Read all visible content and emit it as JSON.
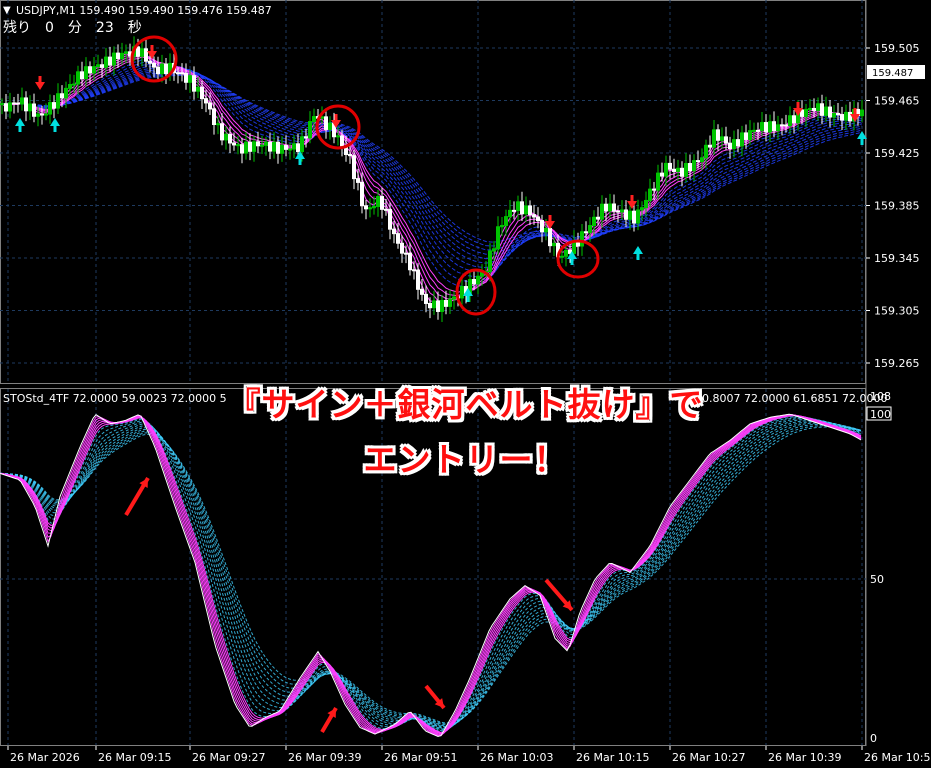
{
  "header": {
    "symbol_line": "USDJPY,M1  159.490 159.490 159.476 159.487",
    "remaining": "残り　0　分　23　秒",
    "dropdown_glyph": "▼"
  },
  "price_panel": {
    "price_labels": [
      "159.505",
      "159.465",
      "159.425",
      "159.385",
      "159.345",
      "159.305",
      "159.265"
    ],
    "current_price": "159.487"
  },
  "indicator_panel": {
    "title": "STOStd_4TF 72.0000 59.0023 72.0000 5",
    "title_tail": "60.8007 72.0000 61.6851 72.0000",
    "right_scale": [
      "108",
      "100",
      "50",
      "0"
    ]
  },
  "time_axis": [
    "26 Mar 2026",
    "26 Mar 09:15",
    "26 Mar 09:27",
    "26 Mar 09:39",
    "26 Mar 09:51",
    "26 Mar 10:03",
    "26 Mar 10:15",
    "26 Mar 10:27",
    "26 Mar 10:39",
    "26 Mar 10:5"
  ],
  "overlay": {
    "line1": "『サイン＋銀河ベルト抜け』で",
    "line2": "エントリー！"
  },
  "colors": {
    "bull_candle": "#00c400",
    "bear_candle": "#ffffff",
    "belt_fast": "#ff40ff",
    "belt_slow": "#2040ff",
    "sto_fast": "#ff40ff",
    "sto_slow": "#40d0ff",
    "signal_up": "#00e0e0",
    "signal_down": "#ff2020",
    "circle": "#e00000"
  },
  "signals": [
    {
      "type": "sell",
      "time_index": 36
    },
    {
      "type": "sell",
      "time_index": 83
    },
    {
      "type": "buy",
      "time_index": 118
    },
    {
      "type": "buy",
      "time_index": 143
    }
  ]
}
